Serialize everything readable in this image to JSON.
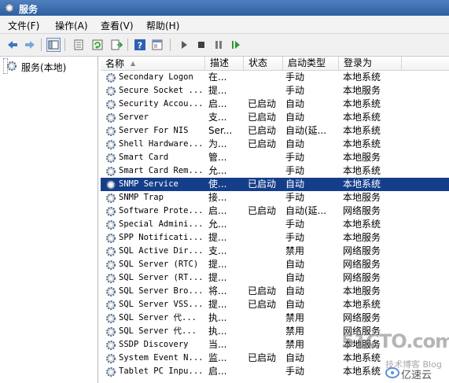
{
  "window": {
    "title": "服务"
  },
  "menu": [
    "文件(F)",
    "操作(A)",
    "查看(V)",
    "帮助(H)"
  ],
  "tree": {
    "root_label": "服务(本地)"
  },
  "columns": {
    "name": "名称",
    "desc": "描述",
    "status": "状态",
    "startup": "启动类型",
    "logon": "登录为"
  },
  "services": [
    {
      "name": "Secondary Logon",
      "desc": "在...",
      "status": "",
      "startup": "手动",
      "logon": "本地系统"
    },
    {
      "name": "Secure Socket ...",
      "desc": "提...",
      "status": "",
      "startup": "手动",
      "logon": "本地服务"
    },
    {
      "name": "Security Accou...",
      "desc": "启...",
      "status": "已启动",
      "startup": "自动",
      "logon": "本地系统"
    },
    {
      "name": "Server",
      "desc": "支...",
      "status": "已启动",
      "startup": "自动",
      "logon": "本地系统"
    },
    {
      "name": "Server For NIS",
      "desc": "Ser...",
      "status": "已启动",
      "startup": "自动(延...",
      "logon": "本地系统"
    },
    {
      "name": "Shell Hardware...",
      "desc": "为...",
      "status": "已启动",
      "startup": "自动",
      "logon": "本地系统"
    },
    {
      "name": "Smart Card",
      "desc": "管...",
      "status": "",
      "startup": "手动",
      "logon": "本地服务"
    },
    {
      "name": "Smart Card Rem...",
      "desc": "允...",
      "status": "",
      "startup": "手动",
      "logon": "本地系统"
    },
    {
      "name": "SNMP Service",
      "desc": "使...",
      "status": "已启动",
      "startup": "自动",
      "logon": "本地系统"
    },
    {
      "name": "SNMP Trap",
      "desc": "接...",
      "status": "",
      "startup": "手动",
      "logon": "本地服务"
    },
    {
      "name": "Software Prote...",
      "desc": "启...",
      "status": "已启动",
      "startup": "自动(延...",
      "logon": "网络服务"
    },
    {
      "name": "Special Admini...",
      "desc": "允...",
      "status": "",
      "startup": "手动",
      "logon": "本地系统"
    },
    {
      "name": "SPP Notificati...",
      "desc": "提...",
      "status": "",
      "startup": "手动",
      "logon": "本地服务"
    },
    {
      "name": "SQL Active Dir...",
      "desc": "支...",
      "status": "",
      "startup": "禁用",
      "logon": "网络服务"
    },
    {
      "name": "SQL Server (RTC)",
      "desc": "提...",
      "status": "",
      "startup": "自动",
      "logon": "网络服务"
    },
    {
      "name": "SQL Server (RT...",
      "desc": "提...",
      "status": "",
      "startup": "自动",
      "logon": "网络服务"
    },
    {
      "name": "SQL Server Bro...",
      "desc": "将...",
      "status": "已启动",
      "startup": "自动",
      "logon": "本地服务"
    },
    {
      "name": "SQL Server VSS...",
      "desc": "提...",
      "status": "已启动",
      "startup": "自动",
      "logon": "本地系统"
    },
    {
      "name": "SQL Server 代...",
      "desc": "执...",
      "status": "",
      "startup": "禁用",
      "logon": "网络服务"
    },
    {
      "name": "SQL Server 代...",
      "desc": "执...",
      "status": "",
      "startup": "禁用",
      "logon": "网络服务"
    },
    {
      "name": "SSDP Discovery",
      "desc": "当...",
      "status": "",
      "startup": "禁用",
      "logon": "本地服务"
    },
    {
      "name": "System Event N...",
      "desc": "监...",
      "status": "已启动",
      "startup": "自动",
      "logon": "本地系统"
    },
    {
      "name": "Tablet PC Inpu...",
      "desc": "启...",
      "status": "",
      "startup": "手动",
      "logon": "本地系统"
    }
  ],
  "selected_index": 8,
  "watermark": {
    "site": "51CTO.com",
    "sub": "技术博客 Blog",
    "brand": "亿速云"
  },
  "colors": {
    "selection": "#153e8a",
    "title_bar": "#2f5f9f"
  }
}
